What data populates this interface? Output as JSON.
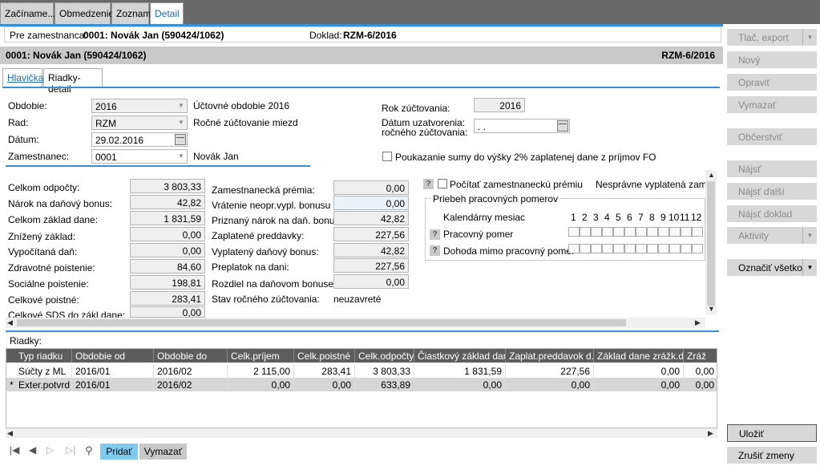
{
  "top_tabs": [
    {
      "label": "Začíname..."
    },
    {
      "label": "Obmedzenie"
    },
    {
      "label": "Zoznam"
    },
    {
      "label": "Detail"
    }
  ],
  "infobar": {
    "employee_label": "Pre zamestnanca:",
    "employee_value": "0001: Novák Jan (590424/1062)",
    "doc_label": "Doklad:",
    "doc_value": "RZM-6/2016"
  },
  "titlebar": {
    "left": "0001: Novák Jan (590424/1062)",
    "right": "RZM-6/2016"
  },
  "sub_tabs": [
    {
      "label": "Hlavička"
    },
    {
      "label": "Riadky-detail"
    }
  ],
  "header": {
    "obdobie_label": "Obdobie:",
    "obdobie_value": "2016",
    "obdobie_desc": "Účtovné obdobie 2016",
    "rad_label": "Rad:",
    "rad_value": "RZM",
    "rad_desc": "Ročné zúčtovanie miezd",
    "datum_label": "Dátum:",
    "datum_value": "29.02.2016",
    "zam_label": "Zamestnanec:",
    "zam_value": "0001",
    "zam_desc": "Novák Jan",
    "rok_label": "Rok zúčtovania:",
    "rok_value": "2016",
    "datum_uzav_label1": "Dátum uzatvorenia:",
    "datum_uzav_label2": "ročného zúčtovania:",
    "datum_uzav_value": ". .",
    "poukazanie_label": "Poukazanie sumy do výšky 2% zaplatenej dane z príjmov FO"
  },
  "col1": [
    {
      "label": "Celkom odpočty:",
      "value": "3 803,33"
    },
    {
      "label": "Nárok na daňový bonus:",
      "value": "42,82"
    },
    {
      "label": "Celkom základ dane:",
      "value": "1 831,59"
    },
    {
      "label": "Znížený základ:",
      "value": "0,00"
    },
    {
      "label": "Vypočítaná daň:",
      "value": "0,00"
    },
    {
      "label": "Zdravotné poistenie:",
      "value": "84,60"
    },
    {
      "label": "Sociálne poistenie:",
      "value": "198,81"
    },
    {
      "label": "Celkové poistné:",
      "value": "283,41"
    },
    {
      "label": "Celkové SDS do zákl.dane:",
      "value": "0,00"
    }
  ],
  "col2": [
    {
      "label": "Zamestnanecká prémia:",
      "value": "0,00"
    },
    {
      "label": "Vrátenie neopr.vypl. bonusu",
      "value": "0,00"
    },
    {
      "label": "Priznaný nárok na daň. bonus:",
      "value": "42,82"
    },
    {
      "label": "Zaplatené preddavky:",
      "value": "227,56"
    },
    {
      "label": "Vyplatený daňový bonus:",
      "value": "42,82"
    },
    {
      "label": "Preplatok na dani:",
      "value": "227,56"
    },
    {
      "label": "Rozdiel na daňovom bonuse:",
      "value": "0,00"
    }
  ],
  "stav": {
    "label": "Stav ročného zúčtovania:",
    "value": "neuzavreté"
  },
  "right_section": {
    "pocitat_label": "Počítať zamestnaneckú prémiu",
    "nespravne_label": "Nesprávne vyplatená zam.pr",
    "priebeh_title": "Priebeh pracovných pomerov",
    "kal_label": "Kalendárny mesiac",
    "months": [
      "1",
      "2",
      "3",
      "4",
      "5",
      "6",
      "7",
      "8",
      "9",
      "10",
      "11",
      "12"
    ],
    "pp_label": "Pracovný pomer",
    "dohoda_label": "Dohoda mimo pracovný pomer"
  },
  "riadky_label": "Riadky:",
  "grid": {
    "columns": [
      "Typ riadku",
      "Obdobie od",
      "Obdobie do",
      "Celk.príjem",
      "Celk.poistné",
      "Celk.odpočty",
      "Čiastkový základ dane",
      "Zaplat.preddavok d.",
      "Základ dane zrážk.daň",
      "Zráž"
    ],
    "rows": [
      {
        "marker": "",
        "cells": [
          "Súčty z ML",
          "2016/01",
          "2016/02",
          "2 115,00",
          "283,41",
          "3 803,33",
          "1 831,59",
          "227,56",
          "0,00",
          "0,00"
        ]
      },
      {
        "marker": "*",
        "cells": [
          "Exter.potvrd",
          "2016/01",
          "2016/02",
          "0,00",
          "0,00",
          "633,89",
          "0,00",
          "0,00",
          "0,00",
          "0,00"
        ]
      }
    ]
  },
  "bottom": {
    "pridat": "Pridať",
    "vymazat": "Vymazať"
  },
  "right_buttons": {
    "tlac": "Tlač, export",
    "novy": "Nový",
    "opravit": "Opraviť",
    "vymazat": "Vymazať",
    "obcerstvit": "Občerstviť",
    "najst": "Nájsť",
    "najst_dalsi": "Nájsť ďalší",
    "najst_doklad": "Nájsť doklad",
    "aktivity": "Aktivity",
    "oznacit": "Označiť všetko",
    "ulozit": "Uložiť",
    "zrusit": "Zrušiť zmeny"
  },
  "colors": {
    "accent": "#3a8fd3",
    "header_bg": "#5d5d5d",
    "topbar": "#6a6a6a"
  }
}
